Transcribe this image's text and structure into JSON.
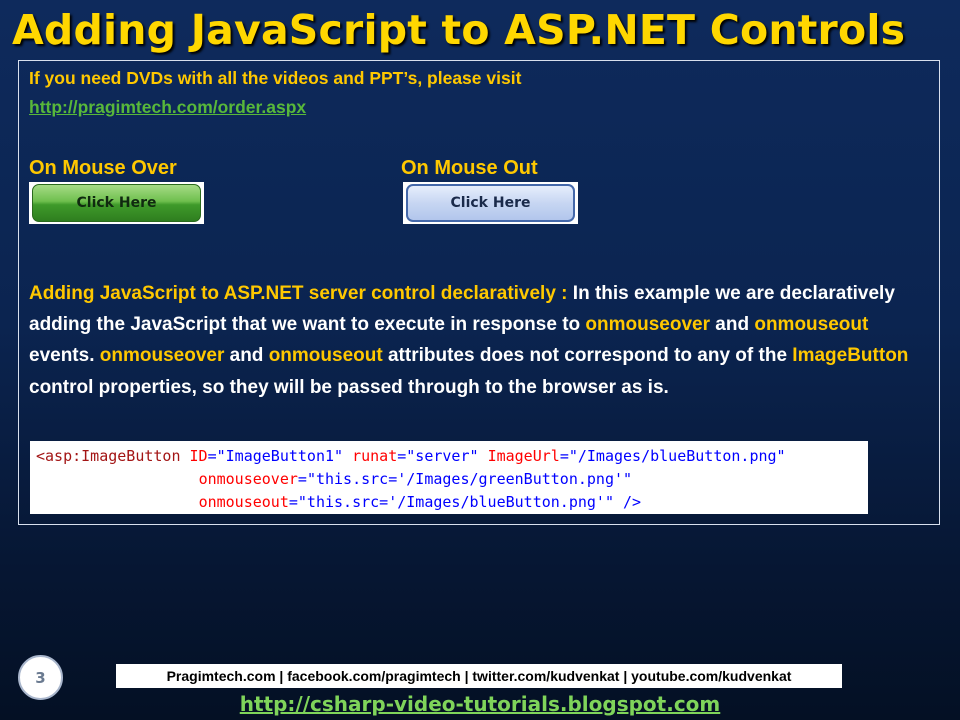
{
  "slide": {
    "title": "Adding JavaScript to ASP.NET Controls",
    "page_number": "3"
  },
  "intro": {
    "dvd_text": "If you need DVDs with all the videos and PPT’s, please visit",
    "dvd_link": "http://pragimtech.com/order.aspx"
  },
  "demo": {
    "mouse_over_label": "On Mouse Over",
    "mouse_out_label": "On Mouse Out",
    "green_button_label": "Click Here",
    "blue_button_label": "Click Here"
  },
  "paragraph": {
    "heading": "Adding JavaScript to ASP.NET server control declaratively :",
    "part1": " In this example we are declaratively adding the JavaScript that we want to execute in response to ",
    "kw_onmouseover": "onmouseover",
    "and1": " and ",
    "kw_onmouseout": "onmouseout",
    "part2": " events. ",
    "kw_onmouseover2": "onmouseover",
    "and2": " and ",
    "kw_onmouseout2": "onmouseout",
    "part3": " attributes does not correspond to any of the ",
    "kw_imagebutton": "ImageButton",
    "part4": " control properties, so they will be passed through to the browser as is."
  },
  "code": {
    "line1": {
      "tag": "<asp:ImageButton",
      "a1": "ID",
      "v1": "\"ImageButton1\"",
      "a2": "runat",
      "v2": "\"server\"",
      "a3": "ImageUrl",
      "v3": "\"/Images/blueButton.png\""
    },
    "line2": {
      "indent": "                  ",
      "attr": "onmouseover",
      "val": "\"this.src='/Images/greenButton.png'\""
    },
    "line3": {
      "indent": "                  ",
      "attr": "onmouseout",
      "val": "\"this.src='/Images/blueButton.png'\"",
      "end": " />"
    }
  },
  "footer": {
    "links_bar": "Pragimtech.com | facebook.com/pragimtech | twitter.com/kudvenkat | youtube.com/kudvenkat",
    "blog_url": "http://csharp-video-tutorials.blogspot.com"
  },
  "colors": {
    "title": "#ffd700",
    "highlight": "#ffc800",
    "link_green": "#58b83a",
    "background_top": "#0e2a5c",
    "background_bottom": "#041024"
  }
}
